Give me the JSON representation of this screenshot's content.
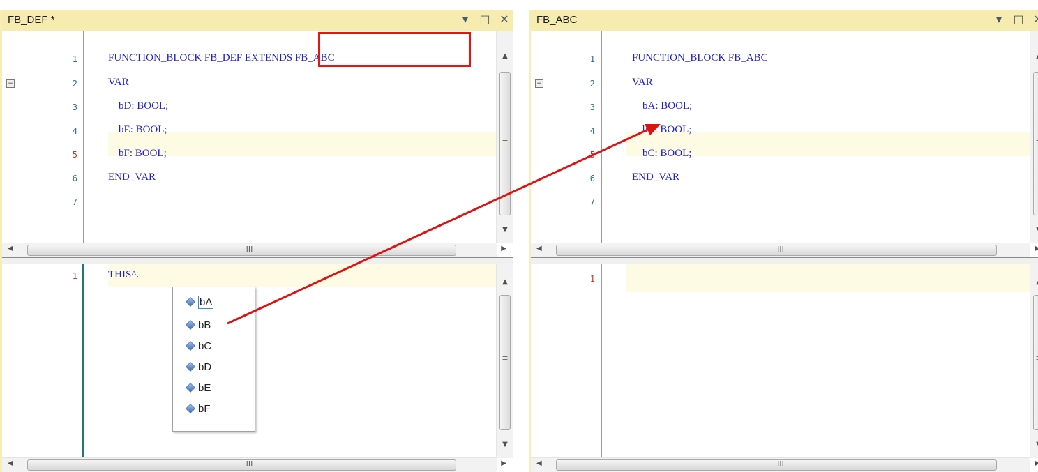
{
  "left": {
    "title": "FB_DEF *",
    "controls": [
      "▾",
      "□",
      "✕"
    ],
    "top_lines": [
      {
        "num": "1",
        "text": "FUNCTION_BLOCK FB_DEF EXTENDS FB_ABC"
      },
      {
        "num": "2",
        "text": "VAR"
      },
      {
        "num": "3",
        "text": "    bD: BOOL;"
      },
      {
        "num": "4",
        "text": "    bE: BOOL;"
      },
      {
        "num": "5",
        "text": "    bF: BOOL;"
      },
      {
        "num": "6",
        "text": "END_VAR"
      },
      {
        "num": "7",
        "text": ""
      }
    ],
    "bottom_lines": [
      {
        "num": "1",
        "text": "THIS^."
      }
    ],
    "autocomplete": [
      "bA",
      "bB",
      "bC",
      "bD",
      "bE",
      "bF"
    ],
    "autocomplete_selected": "bA"
  },
  "right": {
    "title": "FB_ABC",
    "controls": [
      "▾",
      "□",
      "✕"
    ],
    "top_lines": [
      {
        "num": "1",
        "text": "FUNCTION_BLOCK FB_ABC"
      },
      {
        "num": "2",
        "text": "VAR"
      },
      {
        "num": "3",
        "text": "    bA: BOOL;"
      },
      {
        "num": "4",
        "text": "    bB: BOOL;"
      },
      {
        "num": "5",
        "text": "    bC: BOOL;"
      },
      {
        "num": "6",
        "text": "END_VAR"
      },
      {
        "num": "7",
        "text": ""
      }
    ],
    "bottom_lines": [
      {
        "num": "1",
        "text": ""
      }
    ]
  },
  "scroll_grip": "III",
  "colors": {
    "titlebar": "#f7ecaf",
    "keyword": "#2222cc",
    "highlight_line": "#fdfbe3",
    "annotation": "#e11111"
  }
}
